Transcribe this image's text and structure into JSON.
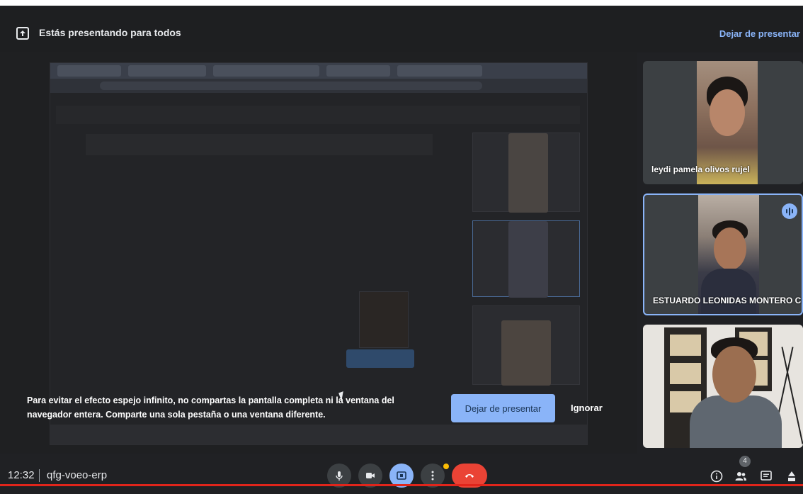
{
  "presenting_bar": {
    "message": "Estás presentando para todos",
    "stop_label": "Dejar de presentar"
  },
  "notice": {
    "message": "Para evitar el efecto espejo infinito, no compartas la pantalla completa ni la ventana del navegador entera. Comparte una sola pestaña o una ventana diferente.",
    "stop_button": "Dejar de presentar",
    "ignore_button": "Ignorar"
  },
  "participants": [
    {
      "name": "leydi pamela olivos rujel",
      "speaking": false
    },
    {
      "name": "ESTUARDO LEONIDAS MONTERO C...",
      "speaking": true
    },
    {
      "name": "",
      "speaking": false
    }
  ],
  "bottom_bar": {
    "time": "12:32",
    "meeting_code": "qfg-voeo-erp",
    "participants_badge": "4"
  },
  "colors": {
    "accent": "#8ab4f8",
    "end_call": "#ea4335",
    "background": "#202124"
  }
}
